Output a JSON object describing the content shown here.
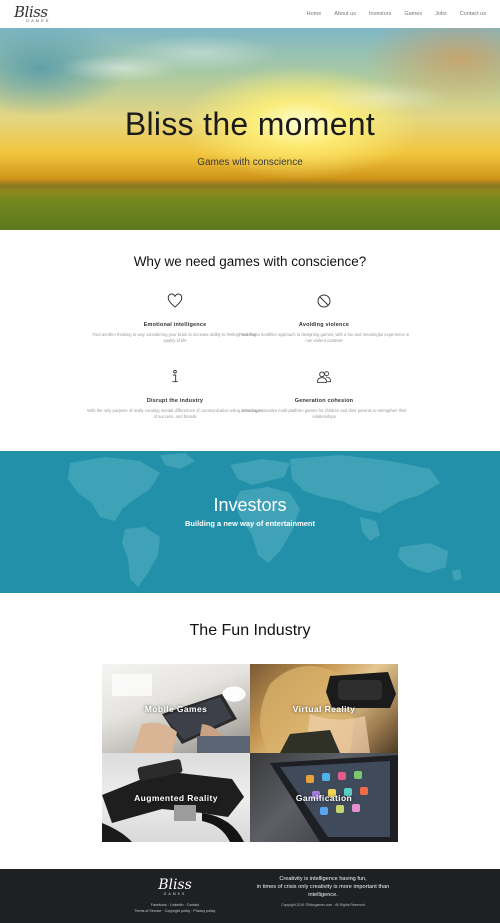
{
  "nav": {
    "logo": "Bliss",
    "logo_sub": "GAMES",
    "links": [
      "Home",
      "About us",
      "Investors",
      "Games",
      "Jobs",
      "Contact us"
    ]
  },
  "hero": {
    "title": "Bliss the moment",
    "subtitle": "Games with conscience"
  },
  "why": {
    "title": "Why we need games with conscience?",
    "features": [
      {
        "icon": "heart-icon",
        "title": "Emotional intelligence",
        "desc": "Find another thinking to way considering your brain to increase ability to feeling, and their quality of life"
      },
      {
        "icon": "no-entry-icon",
        "title": "Avoiding violence",
        "desc": "Providing a healthier approach to designing games, with a fun and meaningful experience in non-violent contexts"
      },
      {
        "icon": "info-icon",
        "title": "Disrupt the industry",
        "desc": "With the only purpose of really creating mental differences of communication using advantages of success, and brands"
      },
      {
        "icon": "people-icon",
        "title": "Generation cohesion",
        "desc": "Creating innovative multi-platform games for children and their parents to strengthen their relationships"
      }
    ]
  },
  "investors": {
    "title": "Investors",
    "subtitle": "Building a new way of entertainment"
  },
  "fun": {
    "title": "The Fun Industry",
    "tiles": [
      "Mobile Games",
      "Virtual Reality",
      "Augmented Reality",
      "Gamification"
    ]
  },
  "footer": {
    "logo": "Bliss",
    "logo_sub": "GAMES",
    "links_line1": "Facebook · LinkedIn · Contact",
    "links_line2": "Terms of Service · Copyright policy · Privacy policy",
    "quote_line1": "Creativity is intelligence having fun,",
    "quote_line2": "in times of crisis only creativity is more important than intelligence.",
    "copyright": "Copyright 2019 ©Blissgames.com · All Rights Reserved"
  },
  "colors": {
    "investors_bg": "#2190a8",
    "footer_bg": "#1f2024"
  }
}
